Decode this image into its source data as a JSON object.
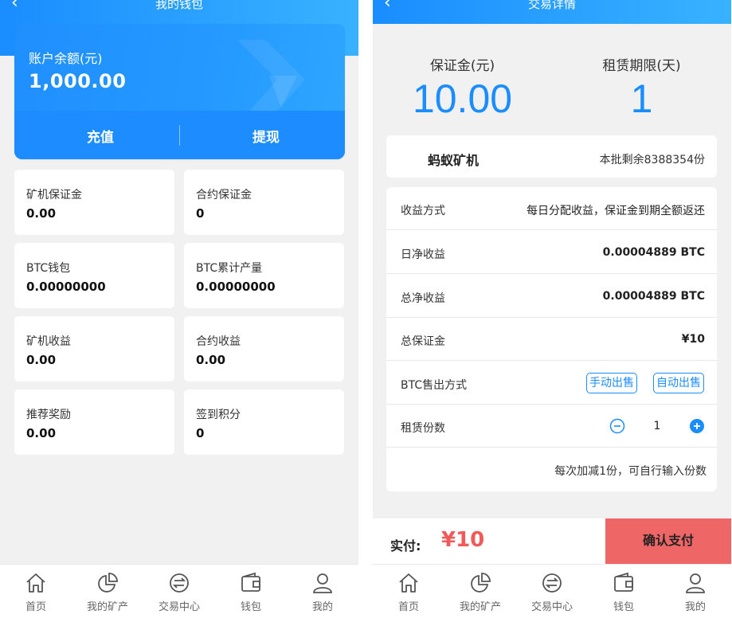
{
  "wallet": {
    "title": "我的钱包",
    "balance_label": "账户余额(元)",
    "balance_value": "1,000.00",
    "recharge_label": "充值",
    "withdraw_label": "提现",
    "stats": [
      {
        "label": "矿机保证金",
        "value": "0.00"
      },
      {
        "label": "合约保证金",
        "value": "0"
      },
      {
        "label": "BTC钱包",
        "value": "0.00000000"
      },
      {
        "label": "BTC累计产量",
        "value": "0.00000000"
      },
      {
        "label": "矿机收益",
        "value": "0.00"
      },
      {
        "label": "合约收益",
        "value": "0.00"
      },
      {
        "label": "推荐奖励",
        "value": "0.00"
      },
      {
        "label": "签到积分",
        "value": "0"
      }
    ]
  },
  "detail": {
    "title": "交易详情",
    "deposit_label": "保证金(元)",
    "deposit_value": "10.00",
    "term_label": "租赁期限(天)",
    "term_value": "1",
    "product_name": "蚂蚁矿机",
    "remaining": "本批剩余8388354份",
    "rows": {
      "income_method": {
        "label": "收益方式",
        "value": "每日分配收益，保证金到期全额返还"
      },
      "daily_net": {
        "label": "日净收益",
        "value": "0.00004889 BTC"
      },
      "total_net": {
        "label": "总净收益",
        "value": "0.00004889 BTC"
      },
      "total_deposit": {
        "label": "总保证金",
        "value": "¥10"
      },
      "sell_method": {
        "label": "BTC售出方式",
        "manual": "手动出售",
        "auto": "自动出售"
      },
      "quantity": {
        "label": "租赁份数",
        "value": "1"
      }
    },
    "hint": "每次加减1份，可自行输入份数",
    "pay_label": "实付:",
    "pay_amount": "¥10",
    "confirm_label": "确认支付"
  },
  "nav": {
    "items": [
      {
        "label": "首页",
        "icon": "home-icon"
      },
      {
        "label": "我的矿产",
        "icon": "pie-chart-icon"
      },
      {
        "label": "交易中心",
        "icon": "exchange-icon"
      },
      {
        "label": "钱包",
        "icon": "wallet-icon"
      },
      {
        "label": "我的",
        "icon": "user-icon"
      }
    ]
  },
  "colors": {
    "primary": "#1a8dff",
    "price_red": "#f25a5a",
    "confirm_bg": "#ef6666"
  }
}
